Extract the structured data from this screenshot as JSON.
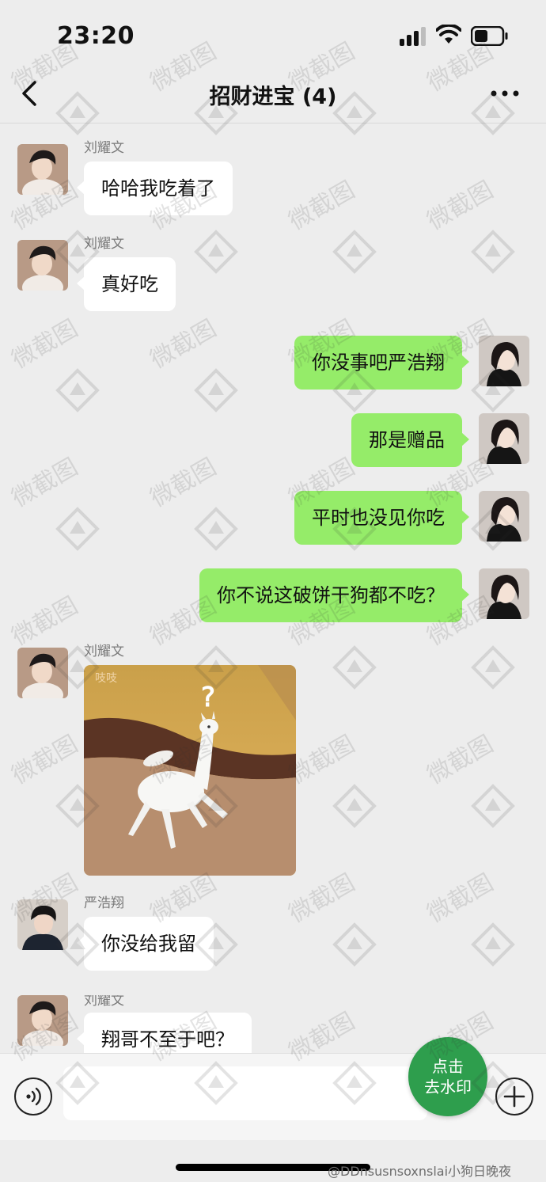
{
  "status_bar": {
    "time": "23:20"
  },
  "header": {
    "title": "招财进宝 (4)"
  },
  "messages": [
    {
      "side": "left",
      "sender": "刘耀文",
      "text": "哈哈我吃着了"
    },
    {
      "side": "left",
      "sender": "刘耀文",
      "text": "真好吃"
    },
    {
      "side": "right",
      "text": "你没事吧严浩翔"
    },
    {
      "side": "right",
      "text": "那是赠品"
    },
    {
      "side": "right",
      "text": "平时也没见你吃"
    },
    {
      "side": "right",
      "text": "你不说这破饼干狗都不吃？"
    },
    {
      "side": "left",
      "sender": "刘耀文",
      "sticker_label": "吱吱",
      "sticker_glyph": "?"
    },
    {
      "side": "left",
      "sender": "严浩翔",
      "text": "你没给我留"
    },
    {
      "side": "left",
      "sender": "刘耀文",
      "text": "翔哥不至于吧？"
    }
  ],
  "watermark_button": {
    "line1": "点击",
    "line2": "去水印"
  },
  "watermark_text": "微截图",
  "credit": "@DDnsusnsoxnslai小狗日晚夜",
  "colors": {
    "background": "#ededed",
    "sent_bubble": "#95ec69",
    "received_bubble": "#ffffff",
    "watermark_button": "#2e9e4d"
  }
}
